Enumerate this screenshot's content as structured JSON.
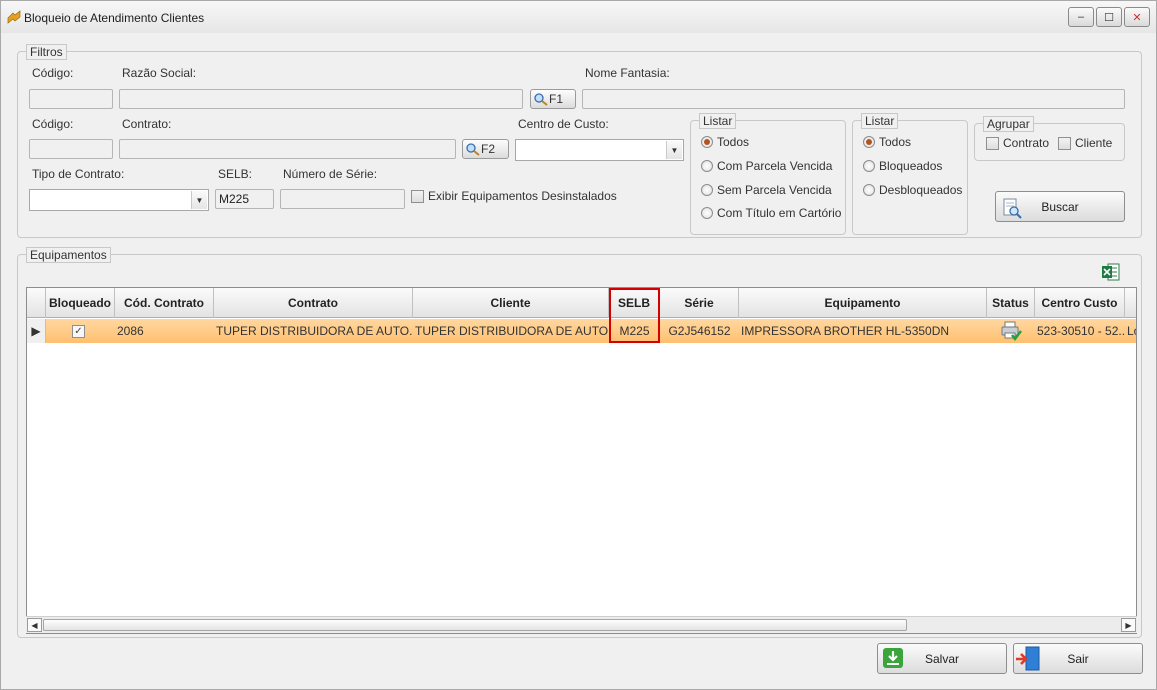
{
  "window": {
    "title": "Bloqueio de Atendimento Clientes",
    "buttons": {
      "minimize": "–",
      "maximize": "☐",
      "close": "✕"
    }
  },
  "filtros": {
    "legend": "Filtros",
    "codigo1_label": "Código:",
    "razao_social_label": "Razão Social:",
    "nome_fantasia_label": "Nome Fantasia:",
    "f1_label": "F1",
    "codigo2_label": "Código:",
    "contrato_label": "Contrato:",
    "f2_label": "F2",
    "centro_custo_label": "Centro de Custo:",
    "tipo_contrato_label": "Tipo de Contrato:",
    "selb_label": "SELB:",
    "selb_value": "M225",
    "numero_serie_label": "Número de Série:",
    "exibir_label": "Exibir Equipamentos Desinstalados"
  },
  "listar1": {
    "legend": "Listar",
    "options": [
      "Todos",
      "Com Parcela Vencida",
      "Sem Parcela Vencida",
      "Com Título em Cartório"
    ]
  },
  "listar2": {
    "legend": "Listar",
    "options": [
      "Todos",
      "Bloqueados",
      "Desbloqueados"
    ]
  },
  "agrupar": {
    "legend": "Agrupar",
    "contrato": "Contrato",
    "cliente": "Cliente"
  },
  "buscar_label": "Buscar",
  "equipamentos": {
    "legend": "Equipamentos",
    "columns": [
      "Bloqueado",
      "Cód. Contrato",
      "Contrato",
      "Cliente",
      "SELB",
      "Série",
      "Equipamento",
      "Status",
      "Centro Custo"
    ],
    "row": {
      "bloqueado": "✓",
      "cod_contrato": "2086",
      "contrato": "TUPER DISTRIBUIDORA DE AUTO...",
      "cliente": "TUPER DISTRIBUIDORA DE AUTO...",
      "selb": "M225",
      "serie": "G2J546152",
      "equipamento": "IMPRESSORA BROTHER HL-5350DN",
      "centro_custo": "523-30510 - 52...",
      "extra": "Lo"
    }
  },
  "footer": {
    "salvar": "Salvar",
    "sair": "Sair"
  }
}
